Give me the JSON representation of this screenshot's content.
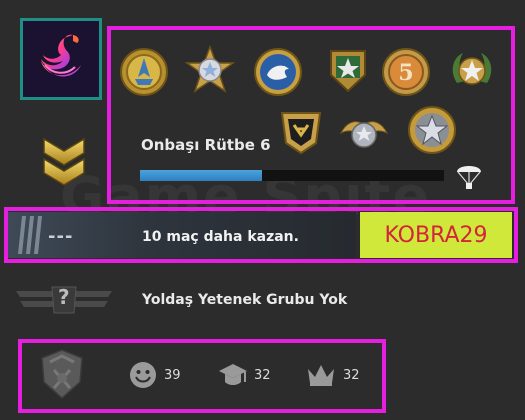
{
  "profile": {
    "rank_title": "Onbaşı Rütbe 6",
    "xp_progress": 0.4
  },
  "win": {
    "skill_placeholder": "---",
    "text": "10 maç daha kazan.",
    "code": "KOBRA29"
  },
  "friend": {
    "text": "Yoldaş Yetenek Grubu Yok",
    "badge_glyph": "?"
  },
  "stats": {
    "friendly": "39",
    "teacher": "32",
    "leader": "32"
  },
  "watermark": "Game Spite",
  "colors": {
    "highlight": "#e61ee0",
    "code_bg": "#cfe83a",
    "code_text": "#d3243a",
    "xp_fill": "#4aa3df",
    "avatar_border": "#1f8f85"
  },
  "medals": [
    "medal-gold-service",
    "medal-silver-star",
    "medal-blue-bird",
    "medal-green-star-shield",
    "medal-five-year",
    "medal-wreath-star",
    "medal-gold-operation",
    "medal-silver-eagle",
    "medal-silver-star-gold-ring"
  ]
}
